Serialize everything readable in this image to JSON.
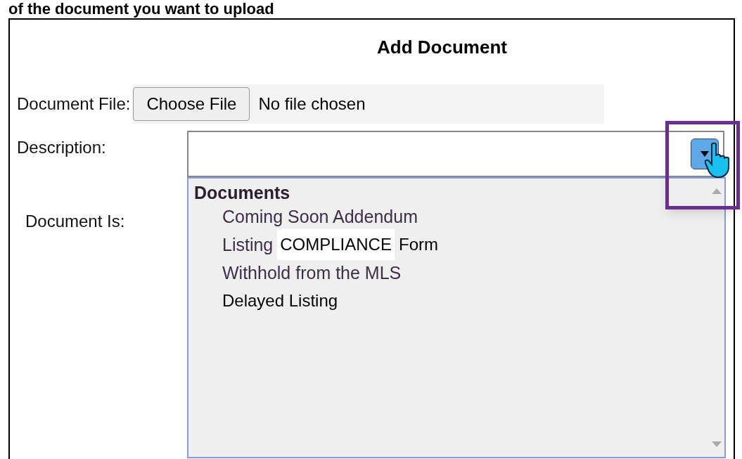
{
  "caption": "of the document you want to upload",
  "dialog": {
    "title": "Add Document",
    "file": {
      "label": "Document File:",
      "button": "Choose File",
      "status": "No file chosen"
    },
    "description": {
      "label": "Description:",
      "expanded": true,
      "highlighted": true
    },
    "document_is": {
      "label": "Document Is:"
    },
    "listbox": {
      "group": "Documents",
      "options": [
        {
          "parts": [
            {
              "text": "Coming Soon Addendum",
              "kind": "original"
            }
          ]
        },
        {
          "parts": [
            {
              "text": "Listing",
              "kind": "original"
            },
            {
              "text": "COMPLIANCE",
              "kind": "patch"
            },
            {
              "text": "Form",
              "kind": "plain"
            }
          ]
        },
        {
          "parts": [
            {
              "text": "Withhold from the MLS",
              "kind": "original"
            }
          ]
        },
        {
          "parts": [
            {
              "text": "Delayed Listing",
              "kind": "plain"
            }
          ]
        }
      ]
    }
  }
}
